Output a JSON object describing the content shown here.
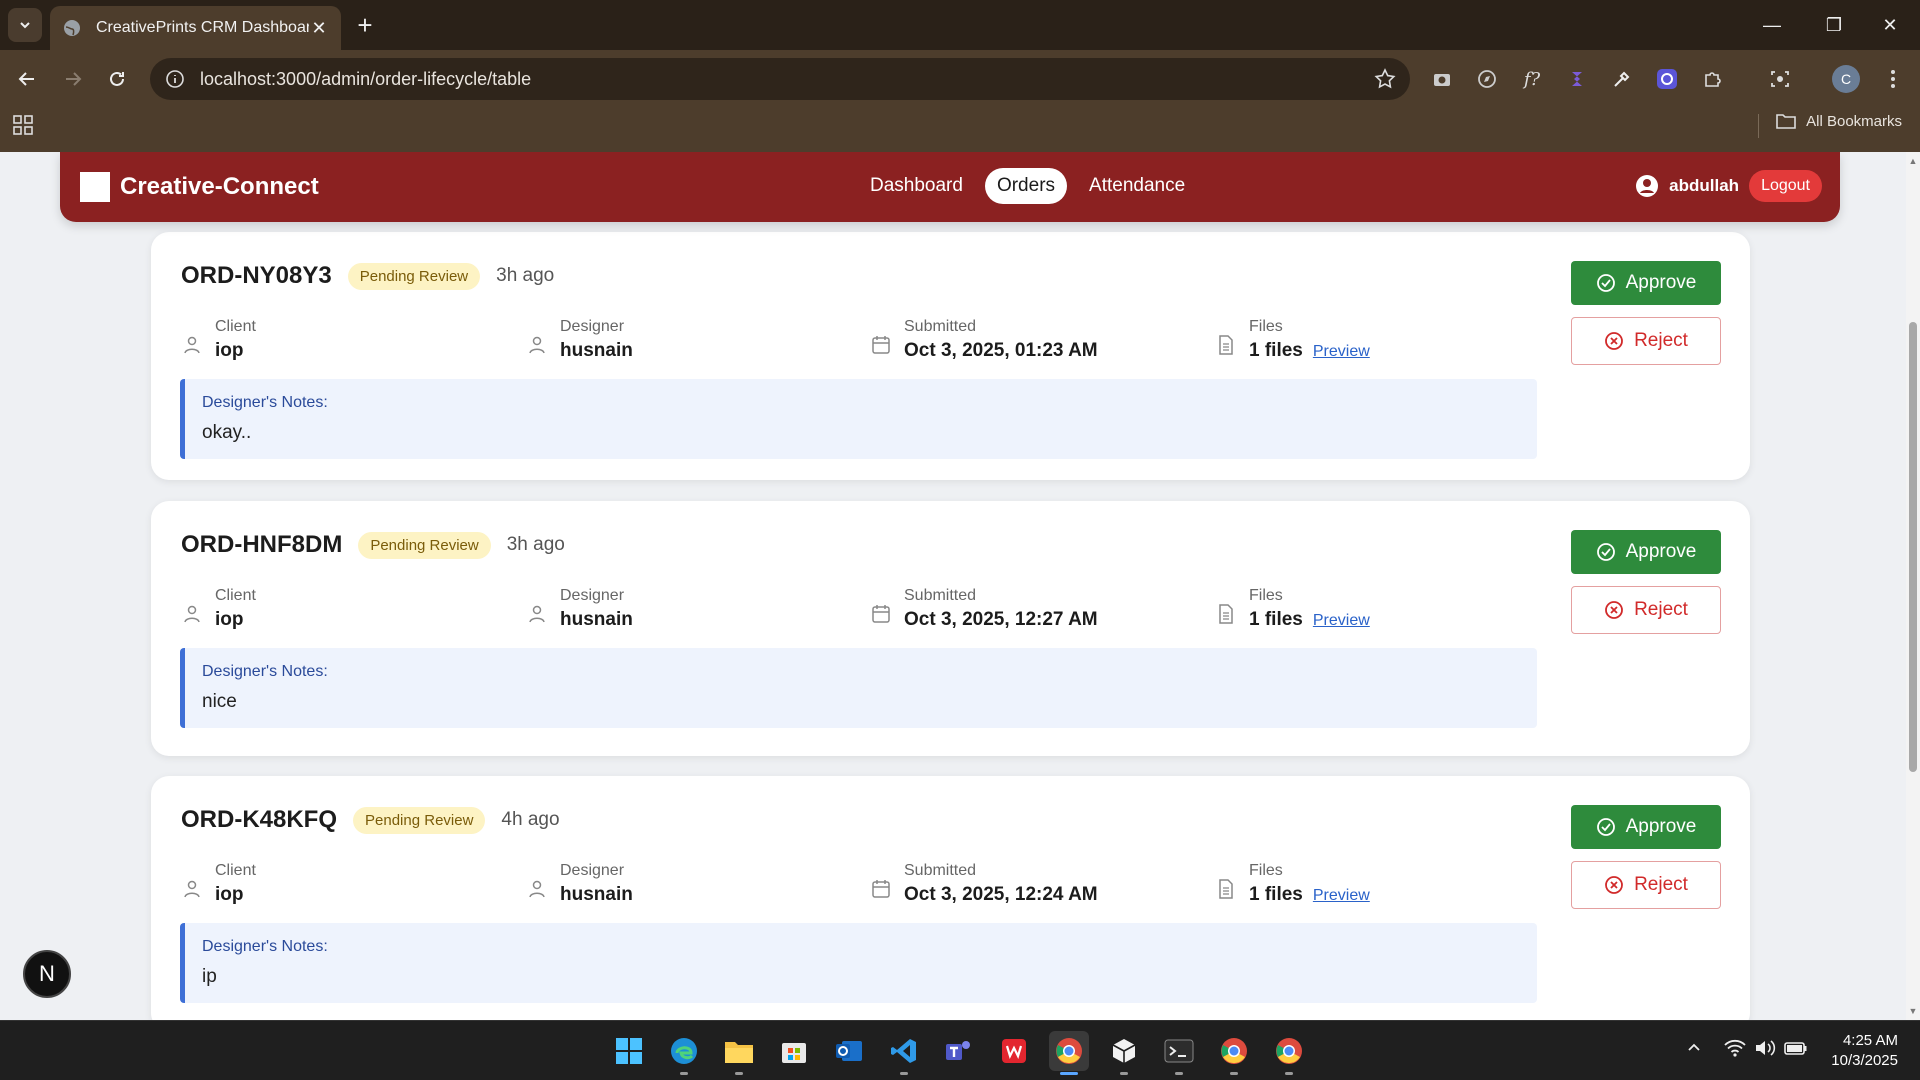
{
  "browser": {
    "tab_title": "CreativePrints CRM Dashboard",
    "url": "localhost:3000/admin/order-lifecycle/table",
    "bookmarks_label": "All Bookmarks",
    "profile_initial": "C"
  },
  "app": {
    "brand": "Creative-Connect",
    "nav": [
      {
        "label": "Dashboard",
        "active": false
      },
      {
        "label": "Orders",
        "active": true
      },
      {
        "label": "Attendance",
        "active": false
      }
    ],
    "username": "abdullah",
    "logout_label": "Logout"
  },
  "orders": [
    {
      "id": "ORD-NY08Y3",
      "status": "Pending Review",
      "ago": "3h ago",
      "client_label": "Client",
      "client": "iop",
      "designer_label": "Designer",
      "designer": "husnain",
      "submitted_label": "Submitted",
      "submitted": "Oct 3, 2025, 01:23 AM",
      "files_label": "Files",
      "files": "1 files",
      "preview": "Preview",
      "notes_label": "Designer's Notes:",
      "notes": "okay..",
      "approve": "Approve",
      "reject": "Reject"
    },
    {
      "id": "ORD-HNF8DM",
      "status": "Pending Review",
      "ago": "3h ago",
      "client_label": "Client",
      "client": "iop",
      "designer_label": "Designer",
      "designer": "husnain",
      "submitted_label": "Submitted",
      "submitted": "Oct 3, 2025, 12:27 AM",
      "files_label": "Files",
      "files": "1 files",
      "preview": "Preview",
      "notes_label": "Designer's Notes:",
      "notes": "nice",
      "approve": "Approve",
      "reject": "Reject"
    },
    {
      "id": "ORD-K48KFQ",
      "status": "Pending Review",
      "ago": "4h ago",
      "client_label": "Client",
      "client": "iop",
      "designer_label": "Designer",
      "designer": "husnain",
      "submitted_label": "Submitted",
      "submitted": "Oct 3, 2025, 12:24 AM",
      "files_label": "Files",
      "files": "1 files",
      "preview": "Preview",
      "notes_label": "Designer's Notes:",
      "notes": "ip",
      "approve": "Approve",
      "reject": "Reject"
    }
  ],
  "dev_badge": "N",
  "taskbar": {
    "time": "4:25 AM",
    "date": "10/3/2025"
  },
  "colors": {
    "app_nav": "#8b2121",
    "approve": "#2e8b3c",
    "reject": "#d12a2a",
    "badge_bg": "#fdf3c4",
    "notes_accent": "#3e6fd6"
  }
}
